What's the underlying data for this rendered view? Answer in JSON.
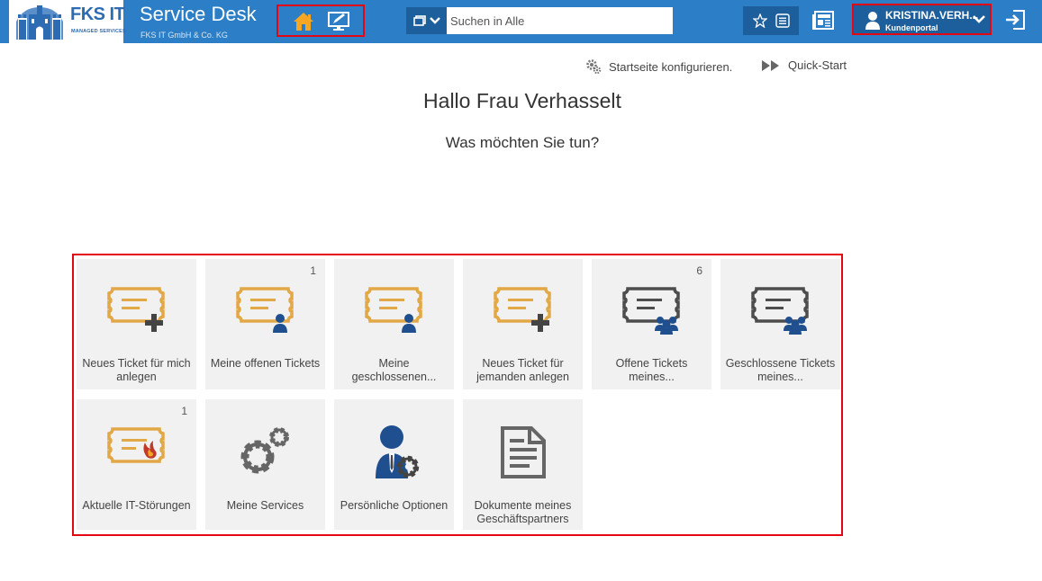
{
  "brand": {
    "logo_text": "FKS IT",
    "logo_subtext": "MANAGED SERVICES",
    "app_title": "Service Desk",
    "company": "FKS IT GmbH & Co. KG"
  },
  "nav": {
    "home_icon": "home-icon",
    "monitor_icon": "monitor-pen-icon"
  },
  "search": {
    "placeholder": "Suchen in Alle"
  },
  "user": {
    "name": "KRISTINA.VERH...",
    "role": "Kundenportal"
  },
  "links": {
    "configure": "Startseite konfigurieren.",
    "quickstart": "Quick-Start"
  },
  "greeting": "Hallo Frau Verhasselt",
  "question": "Was möchten Sie tun?",
  "colors": {
    "header": "#2c7fc6",
    "header_dark": "#1d5f9c",
    "ticket_orange": "#e2a846",
    "ticket_gray": "#4d4d4d",
    "person_blue": "#1f4f8f",
    "highlight_red": "#e30613",
    "tile_bg": "#f1f1f1"
  },
  "tiles": [
    {
      "label": "Neues Ticket für mich anlegen",
      "badge": "",
      "icon": "ticket-plus-icon"
    },
    {
      "label": "Meine offenen Tickets",
      "badge": "1",
      "icon": "ticket-person-icon"
    },
    {
      "label": "Meine geschlossenen...",
      "badge": "",
      "icon": "ticket-person-icon"
    },
    {
      "label": "Neues Ticket für jemanden anlegen",
      "badge": "",
      "icon": "ticket-plus-icon"
    },
    {
      "label": "Offene Tickets meines...",
      "badge": "6",
      "icon": "ticket-group-icon"
    },
    {
      "label": "Geschlossene Tickets meines...",
      "badge": "",
      "icon": "ticket-group-icon"
    },
    {
      "label": "Aktuelle IT-Störungen",
      "badge": "1",
      "icon": "ticket-fire-icon"
    },
    {
      "label": "Meine Services",
      "badge": "",
      "icon": "gears-icon"
    },
    {
      "label": "Persönliche Optionen",
      "badge": "",
      "icon": "person-gear-icon"
    },
    {
      "label": "Dokumente meines Geschäftspartners",
      "badge": "",
      "icon": "document-icon"
    }
  ]
}
